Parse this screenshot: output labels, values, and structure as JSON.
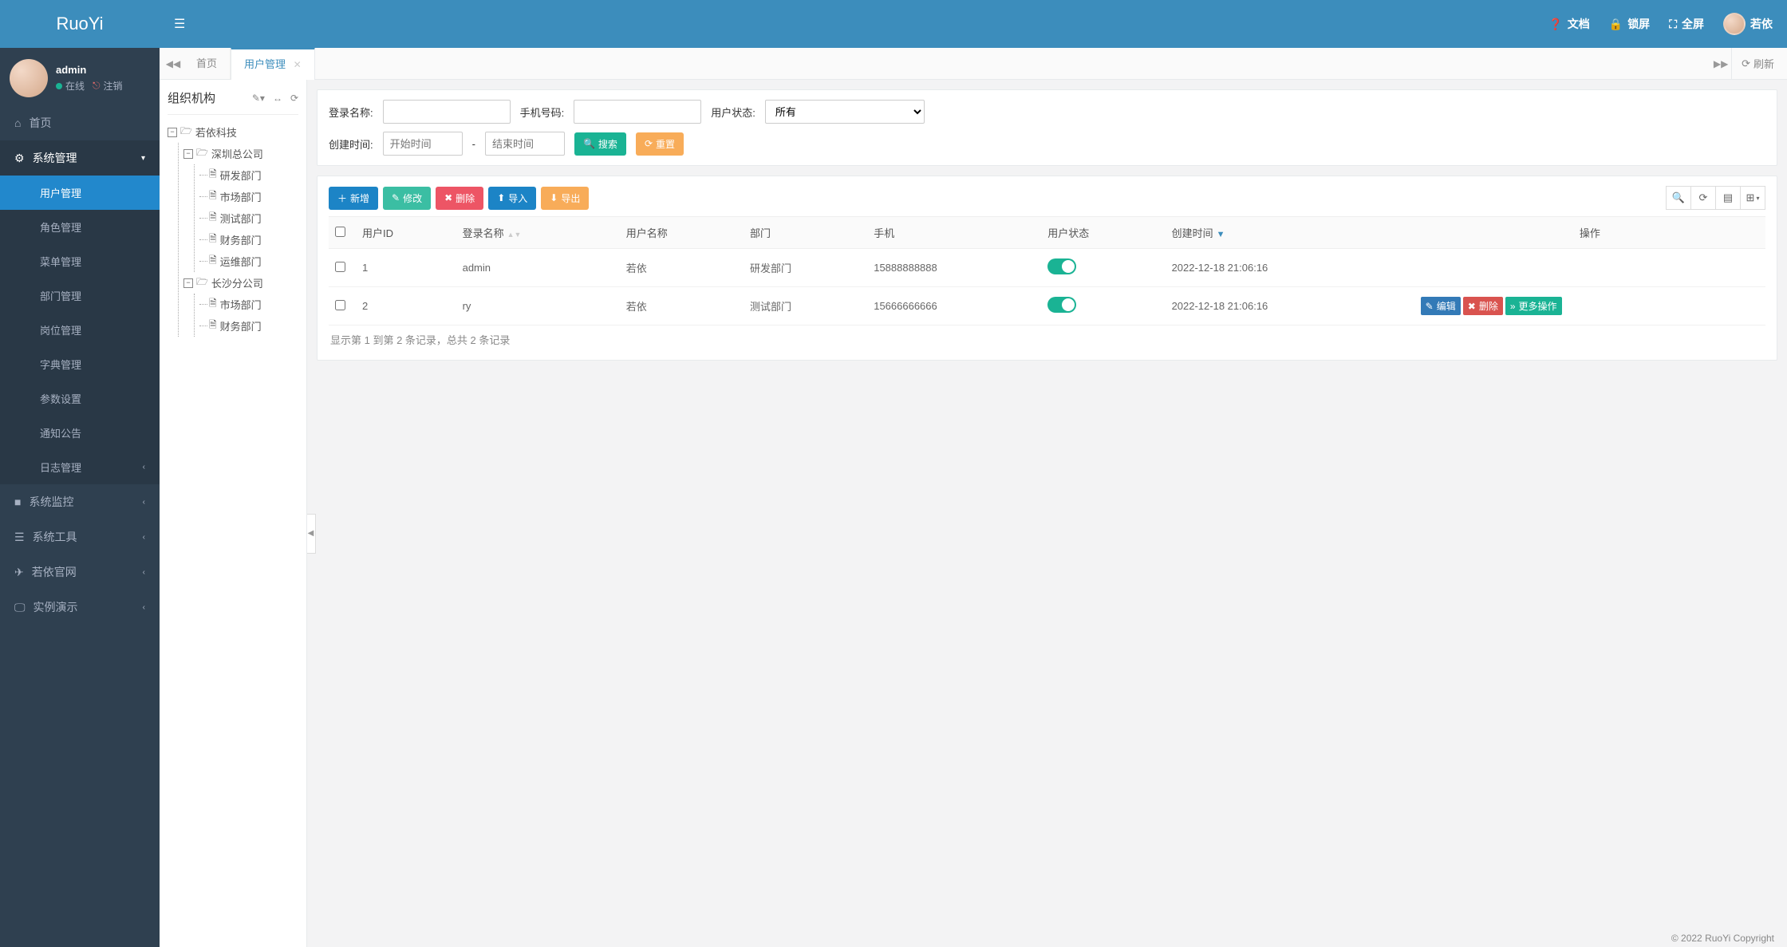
{
  "brand": "RuoYi",
  "header": {
    "docs_label": "文档",
    "lock_label": "锁屏",
    "fullscreen_label": "全屏",
    "user_display": "若依"
  },
  "user_panel": {
    "name": "admin",
    "status_label": "在线",
    "logout_label": "注销"
  },
  "sidebar": {
    "home_label": "首页",
    "sys_label": "系统管理",
    "sys_children": {
      "user": "用户管理",
      "role": "角色管理",
      "menu": "菜单管理",
      "dept": "部门管理",
      "post": "岗位管理",
      "dict": "字典管理",
      "param": "参数设置",
      "notice": "通知公告",
      "log": "日志管理"
    },
    "monitor_label": "系统监控",
    "tool_label": "系统工具",
    "site_label": "若依官网",
    "demo_label": "实例演示"
  },
  "tabs": {
    "home": "首页",
    "active": "用户管理",
    "refresh_label": "刷新"
  },
  "tree": {
    "title": "组织机构",
    "root": "若依科技",
    "shenzhen": "深圳总公司",
    "sz_children": {
      "rd": "研发部门",
      "market": "市场部门",
      "test": "测试部门",
      "finance": "财务部门",
      "ops": "运维部门"
    },
    "changsha": "长沙分公司",
    "cs_children": {
      "market": "市场部门",
      "finance": "财务部门"
    }
  },
  "search": {
    "login_label": "登录名称:",
    "phone_label": "手机号码:",
    "status_label": "用户状态:",
    "status_value": "所有",
    "create_label": "创建时间:",
    "start_placeholder": "开始时间",
    "end_placeholder": "结束时间",
    "search_btn": "搜索",
    "reset_btn": "重置"
  },
  "toolbar": {
    "add": "新增",
    "edit": "修改",
    "delete": "删除",
    "import": "导入",
    "export": "导出"
  },
  "table": {
    "headers": {
      "user_id": "用户ID",
      "login_name": "登录名称",
      "user_name": "用户名称",
      "dept": "部门",
      "phone": "手机",
      "status": "用户状态",
      "create_time": "创建时间",
      "actions": "操作"
    },
    "rows": [
      {
        "id": "1",
        "login": "admin",
        "name": "若依",
        "dept": "研发部门",
        "phone": "15888888888",
        "create_time": "2022-12-18 21:06:16",
        "show_actions": false
      },
      {
        "id": "2",
        "login": "ry",
        "name": "若依",
        "dept": "测试部门",
        "phone": "15666666666",
        "create_time": "2022-12-18 21:06:16",
        "show_actions": true
      }
    ],
    "row_actions": {
      "edit": "编辑",
      "delete": "删除",
      "more": "更多操作"
    }
  },
  "pager": {
    "info": "显示第 1 到第 2 条记录，总共 2 条记录"
  },
  "footer": {
    "copyright": "© 2022 RuoYi Copyright"
  }
}
